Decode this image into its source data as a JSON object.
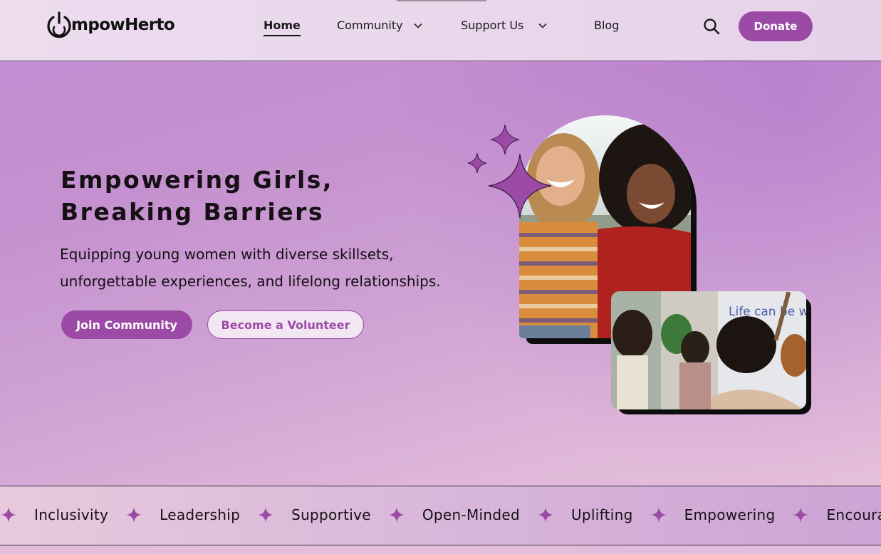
{
  "brand": {
    "name": "mpowHerto",
    "accent": "#9b4aa6"
  },
  "nav": {
    "home": "Home",
    "community": "Community",
    "support": "Support Us",
    "blog": "Blog",
    "donate": "Donate"
  },
  "hero": {
    "title_line1": "Empowering Girls,",
    "title_line2": "Breaking Barriers",
    "subtitle_line1": "Equipping young women with diverse skillsets,",
    "subtitle_line2": "unforgettable experiences, and lifelong relationships.",
    "join_label": "Join Community",
    "volunteer_label": "Become a Volunteer",
    "photo2_sign_text": "Life can be weird."
  },
  "values_marquee": {
    "items": [
      "Inclusivity",
      "Leadership",
      "Supportive",
      "Open-Minded",
      "Uplifting",
      "Empowering",
      "Encourag"
    ]
  },
  "icons": {
    "search": "search-icon",
    "chevron": "chevron-down-icon",
    "sparkle": "sparkle-icon",
    "logo": "power-icon"
  }
}
